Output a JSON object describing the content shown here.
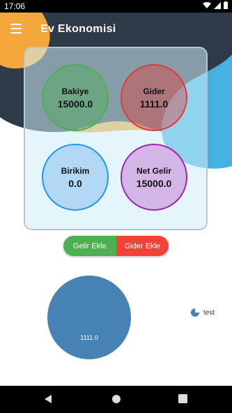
{
  "status": {
    "time": "17:06"
  },
  "appbar": {
    "title": "Ev Ekonomisi"
  },
  "stats": [
    {
      "label": "Bakiye",
      "value": "15000.0"
    },
    {
      "label": "Gider",
      "value": "1111.0"
    },
    {
      "label": "Birikim",
      "value": "0.0"
    },
    {
      "label": "Net Gelir",
      "value": "15000.0"
    }
  ],
  "actions": {
    "add_income": "Gelir Ekle",
    "add_expense": "Gider Ekle"
  },
  "chart_data": {
    "type": "pie",
    "slices": [
      {
        "label": "test",
        "value": 1111.0,
        "color": "#4682b4"
      }
    ],
    "slice_label": "1111.0",
    "legend": [
      "test"
    ]
  },
  "colors": {
    "orange": "#f4a83c",
    "dark": "#2e3a48",
    "blue": "#45b1e0",
    "green": "#4caf50",
    "red": "#f44336"
  }
}
